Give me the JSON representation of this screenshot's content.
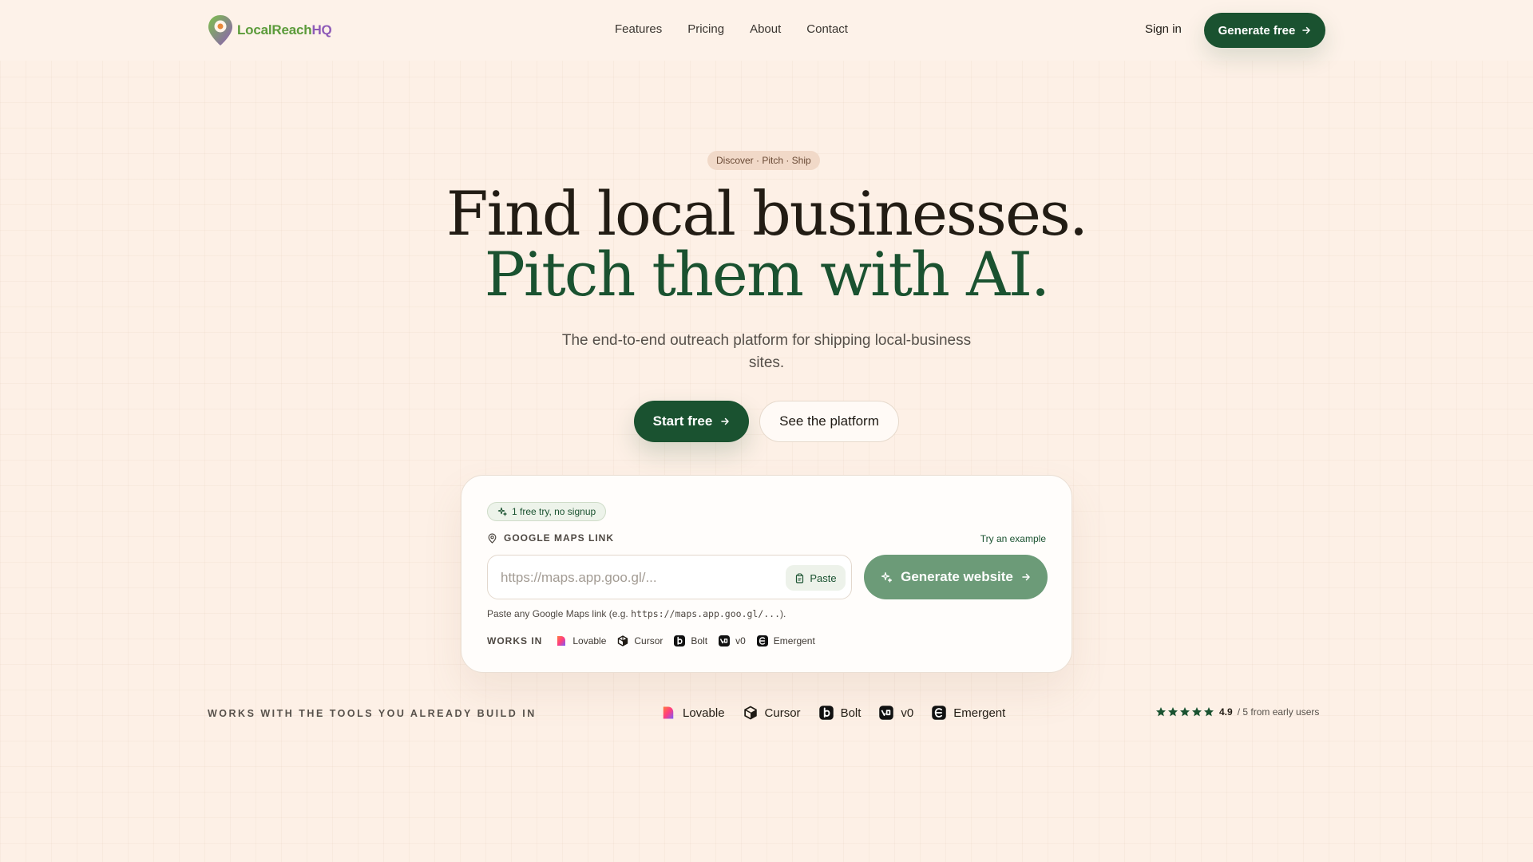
{
  "nav": {
    "logo_text_a": "LocalReach",
    "logo_text_b": "HQ",
    "links": [
      "Features",
      "Pricing",
      "About",
      "Contact"
    ],
    "signin": "Sign in",
    "cta": "Generate free"
  },
  "hero": {
    "tag": "Discover · Pitch · Ship",
    "title_line1": "Find local businesses.",
    "title_line2": "Pitch them with AI.",
    "subtitle": "The end-to-end outreach platform for shipping local-business sites.",
    "primary_cta": "Start free",
    "secondary_cta": "See the platform"
  },
  "card": {
    "trial_badge": "1 free try, no signup",
    "field_label": "GOOGLE MAPS LINK",
    "example_link": "Try an example",
    "url_value": "",
    "url_placeholder": "https://maps.app.goo.gl/...",
    "paste_label": "Paste",
    "generate_label": "Generate website",
    "hint_prefix": "Paste any Google Maps link (e.g. ",
    "hint_code": "https://maps.app.goo.gl/...",
    "hint_suffix": ").",
    "works_in_label": "WORKS IN",
    "tools": [
      {
        "name": "Lovable",
        "icon": "lovable-icon"
      },
      {
        "name": "Cursor",
        "icon": "cursor-icon"
      },
      {
        "name": "Bolt",
        "icon": "bolt-icon"
      },
      {
        "name": "v0",
        "icon": "v0-icon"
      },
      {
        "name": "Emergent",
        "icon": "emergent-icon"
      }
    ]
  },
  "strip": {
    "label": "WORKS WITH THE TOOLS YOU ALREADY BUILD IN",
    "tools": [
      "Lovable",
      "Cursor",
      "Bolt",
      "v0",
      "Emergent"
    ],
    "rating_score": "4.9",
    "rating_text": "/ 5 from early users",
    "stars": 5
  },
  "colors": {
    "brand_green": "#1a5230",
    "muted_green": "#6c9b78",
    "background": "#fdf0e6",
    "logo_purple": "#8e5bb8"
  }
}
